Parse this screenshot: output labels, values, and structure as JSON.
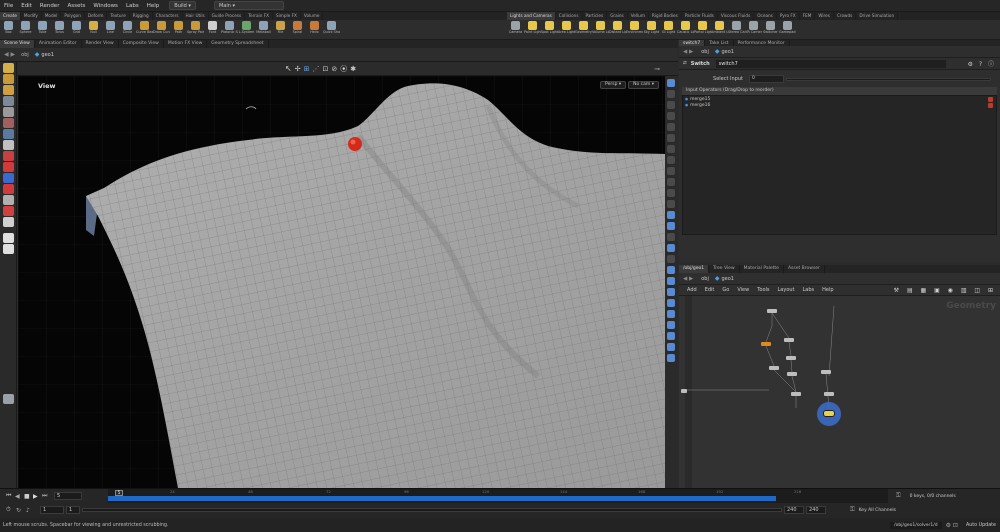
{
  "menubar": {
    "items": [
      "File",
      "Edit",
      "Render",
      "Assets",
      "Windows",
      "Labs",
      "Help"
    ],
    "desktop": "Build",
    "context": "Main"
  },
  "shelf_tabs_left": [
    "Create",
    "Modify",
    "Model",
    "Polygon",
    "Deform",
    "Texture",
    "Rigging",
    "Characters",
    "Hair Utils",
    "Guide Process",
    "Terrain FX",
    "Simple FX",
    "Volume"
  ],
  "shelf_tabs_right": [
    "Lights and Cameras",
    "Collisions",
    "Particles",
    "Grains",
    "Vellum",
    "Rigid Bodies",
    "Particle Fluids",
    "Viscous Fluids",
    "Oceans",
    "Pyro FX",
    "FEM",
    "Wires",
    "Crowds",
    "Drive Simulation"
  ],
  "shelf_tools_left": [
    {
      "label": "Box",
      "icon": "box-icon",
      "color": "#8fa3b8"
    },
    {
      "label": "Sphere",
      "icon": "sphere-icon",
      "color": "#8fa3b8"
    },
    {
      "label": "Tube",
      "icon": "tube-icon",
      "color": "#8fa3b8"
    },
    {
      "label": "Torus",
      "icon": "torus-icon",
      "color": "#8fa3b8"
    },
    {
      "label": "Grid",
      "icon": "grid-icon",
      "color": "#8fa3b8"
    },
    {
      "label": "Null",
      "icon": "null-icon",
      "color": "#d6b042"
    },
    {
      "label": "Line",
      "icon": "line-icon",
      "color": "#8fa3b8"
    },
    {
      "label": "Circle",
      "icon": "circle-icon",
      "color": "#8fa3b8"
    },
    {
      "label": "Curve Bezier",
      "icon": "curve-bezier-icon",
      "color": "#c89a3a"
    },
    {
      "label": "Draw Curve",
      "icon": "draw-curve-icon",
      "color": "#c89a3a"
    },
    {
      "label": "Path",
      "icon": "path-icon",
      "color": "#c89a3a"
    },
    {
      "label": "Spray Paint",
      "icon": "spray-paint-icon",
      "color": "#c89a3a"
    },
    {
      "label": "Font",
      "icon": "font-icon",
      "color": "#cfcfcf"
    },
    {
      "label": "Platonic Solids",
      "icon": "platonic-solids-icon",
      "color": "#8fa3b8"
    },
    {
      "label": "L-System",
      "icon": "l-system-icon",
      "color": "#6aa56a"
    },
    {
      "label": "Metaball",
      "icon": "metaball-icon",
      "color": "#8fa3b8"
    },
    {
      "label": "File",
      "icon": "file-icon",
      "color": "#c9a24a"
    },
    {
      "label": "Spiral",
      "icon": "spiral-icon",
      "color": "#c87a3a"
    },
    {
      "label": "Helix",
      "icon": "helix-icon",
      "color": "#c87a3a"
    },
    {
      "label": "Quick Shapes",
      "icon": "quick-shapes-icon",
      "color": "#8fa3b8"
    }
  ],
  "shelf_tools_right": [
    {
      "label": "Camera",
      "icon": "camera-icon",
      "color": "#9aa3aa"
    },
    {
      "label": "Point Light",
      "icon": "point-light-icon",
      "color": "#e8c84a"
    },
    {
      "label": "Spot Light",
      "icon": "spot-light-icon",
      "color": "#e8c84a"
    },
    {
      "label": "Area Light",
      "icon": "area-light-icon",
      "color": "#e8c84a"
    },
    {
      "label": "Geometry Light",
      "icon": "geometry-light-icon",
      "color": "#e8c84a"
    },
    {
      "label": "Volume Light",
      "icon": "volume-light-icon",
      "color": "#e8c84a"
    },
    {
      "label": "Distant Light",
      "icon": "distant-light-icon",
      "color": "#e8c84a"
    },
    {
      "label": "Environment Light",
      "icon": "environment-light-icon",
      "color": "#e8c84a"
    },
    {
      "label": "Sky Light",
      "icon": "sky-light-icon",
      "color": "#e8c84a"
    },
    {
      "label": "GI Light",
      "icon": "gi-light-icon",
      "color": "#e8c84a"
    },
    {
      "label": "Caustic Light",
      "icon": "caustic-light-icon",
      "color": "#e8c84a"
    },
    {
      "label": "Portal Light",
      "icon": "portal-light-icon",
      "color": "#e8c84a"
    },
    {
      "label": "Ambient Light",
      "icon": "ambient-light-icon",
      "color": "#e8c84a"
    },
    {
      "label": "Stereo Camera",
      "icon": "stereo-camera-icon",
      "color": "#9aa3aa"
    },
    {
      "label": "VR Camera",
      "icon": "vr-camera-icon",
      "color": "#9aa3aa"
    },
    {
      "label": "Switcher",
      "icon": "switcher-icon",
      "color": "#9aa3aa"
    },
    {
      "label": "Gamepad Camera",
      "icon": "gamepad-camera-icon",
      "color": "#9aa3aa"
    }
  ],
  "left_pane_tabs": [
    "Scene View",
    "Animation Editor",
    "Render View",
    "Composite View",
    "Motion FX View",
    "Geometry Spreadsheet"
  ],
  "path_bar": {
    "network": "obj",
    "node": "geo1"
  },
  "viewport": {
    "label": "View",
    "persp": "Persp",
    "cam": "No cam"
  },
  "param_pane_tabs": [
    "switch7",
    "Take List",
    "Performance Monitor"
  ],
  "param_path": {
    "network": "obj",
    "node": "geo1"
  },
  "param": {
    "node_type": "Switch",
    "node_name": "switch7",
    "select_input_label": "Select Input",
    "select_input_value": "0",
    "operators_header": "Input Operators (Drag/Drop to reorder)",
    "operators": [
      "merge15",
      "merge16"
    ]
  },
  "net_pane_tabs": [
    "/obj/geo1",
    "Tree View",
    "Material Palette",
    "Asset Browser"
  ],
  "net_path": {
    "network": "obj",
    "node": "geo1"
  },
  "net_menu": [
    "Add",
    "Edit",
    "Go",
    "View",
    "Tools",
    "Layout",
    "Labs",
    "Help"
  ],
  "net_watermark": "Geometry",
  "timeline": {
    "frame": "5",
    "current_marker": "5",
    "ticks": [
      "24",
      "48",
      "72",
      "96",
      "120",
      "144",
      "168",
      "192",
      "216"
    ],
    "start": "1",
    "start2": "1",
    "end": "240",
    "end2": "240",
    "keys_info": "0 keys, 0/0 channels",
    "key_all": "Key All Channels"
  },
  "status": {
    "message": "Left mouse scrubs. Spacebar for viewing and unrestricted scrubbing.",
    "path": "/obj/geo1/solver1/d",
    "auto_update": "Auto Update"
  }
}
